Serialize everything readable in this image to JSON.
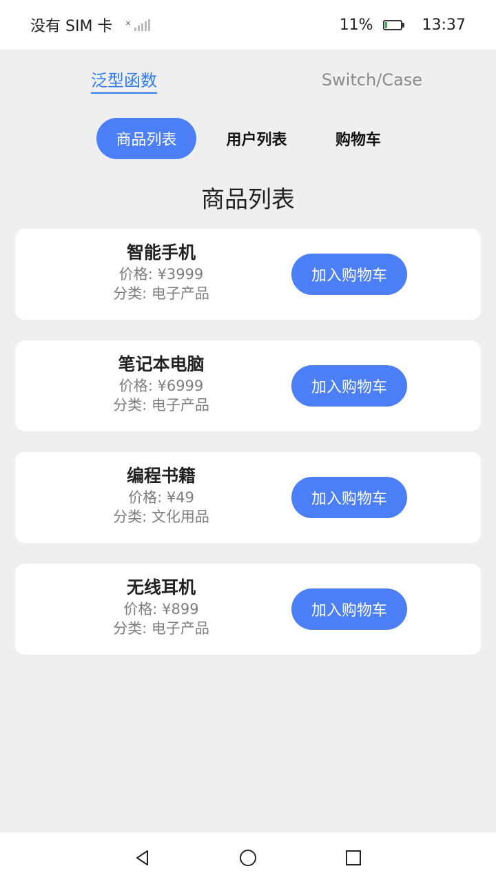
{
  "status_bar": {
    "carrier": "没有 SIM 卡",
    "battery_percent": "11%",
    "battery_level": 0.11,
    "time": "13:37"
  },
  "top_tabs": [
    {
      "label": "泛型函数",
      "active": true
    },
    {
      "label": "Switch/Case",
      "active": false
    }
  ],
  "segments": [
    {
      "label": "商品列表",
      "active": true
    },
    {
      "label": "用户列表",
      "active": false
    },
    {
      "label": "购物车",
      "active": false
    }
  ],
  "page_title": "商品列表",
  "products": [
    {
      "name": "智能手机",
      "price": "价格: ¥3999",
      "category": "分类: 电子产品",
      "button": "加入购物车"
    },
    {
      "name": "笔记本电脑",
      "price": "价格: ¥6999",
      "category": "分类: 电子产品",
      "button": "加入购物车"
    },
    {
      "name": "编程书籍",
      "price": "价格: ¥49",
      "category": "分类: 文化用品",
      "button": "加入购物车"
    },
    {
      "name": "无线耳机",
      "price": "价格: ¥899",
      "category": "分类: 电子产品",
      "button": "加入购物车"
    }
  ],
  "nav": {
    "back": "back-icon",
    "home": "home-icon",
    "recents": "recents-icon"
  },
  "colors": {
    "accent": "#4c7ef5",
    "tab_active": "#2f7df6",
    "background": "#efefef"
  }
}
